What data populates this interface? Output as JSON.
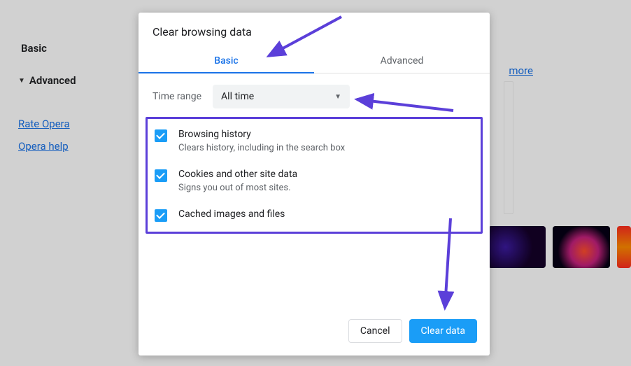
{
  "sidebar": {
    "basic": "Basic",
    "advanced": "Advanced",
    "links": [
      "Rate Opera",
      "Opera help"
    ]
  },
  "right": {
    "more": "more"
  },
  "dialog": {
    "title": "Clear browsing data",
    "tabs": {
      "basic": "Basic",
      "advanced": "Advanced"
    },
    "time_label": "Time range",
    "time_value": "All time",
    "options": [
      {
        "title": "Browsing history",
        "desc": "Clears history, including in the search box"
      },
      {
        "title": "Cookies and other site data",
        "desc": "Signs you out of most sites."
      },
      {
        "title": "Cached images and files",
        "desc": ""
      }
    ],
    "cancel": "Cancel",
    "clear": "Clear data"
  }
}
